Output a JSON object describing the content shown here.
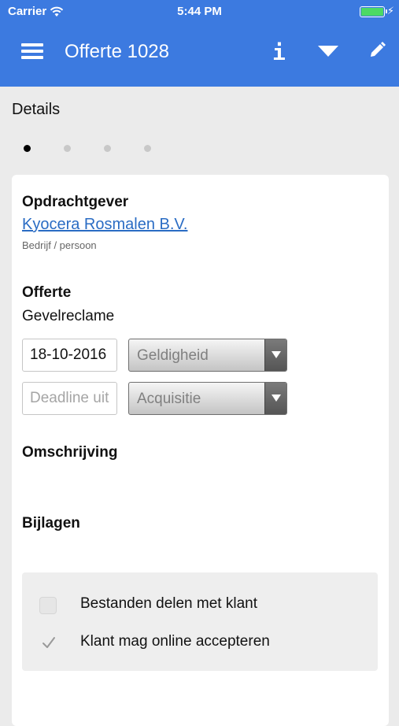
{
  "status_bar": {
    "carrier": "Carrier",
    "time": "5:44 PM"
  },
  "header": {
    "title": "Offerte 1028",
    "info_label": "i",
    "icons": [
      "menu-icon",
      "info-icon",
      "dropdown-icon",
      "edit-icon"
    ],
    "bg_color": "#3c7ae0"
  },
  "section": {
    "title": "Details"
  },
  "pager": {
    "pages": 4,
    "active": 0
  },
  "client": {
    "heading": "Opdrachtgever",
    "name": "Kyocera Rosmalen B.V.",
    "subtitle": "Bedrijf / persoon"
  },
  "offer": {
    "heading": "Offerte",
    "value": "Gevelreclame",
    "date_value": "18-10-2016",
    "validity_select": "Geldigheid",
    "deadline_placeholder": "Deadline uit",
    "phase_select": "Acquisitie"
  },
  "description": {
    "heading": "Omschrijving"
  },
  "attachments": {
    "heading": "Bijlagen",
    "options": [
      {
        "label": "Bestanden delen met klant",
        "checked": false
      },
      {
        "label": "Klant mag online accepteren",
        "checked": true
      }
    ]
  }
}
